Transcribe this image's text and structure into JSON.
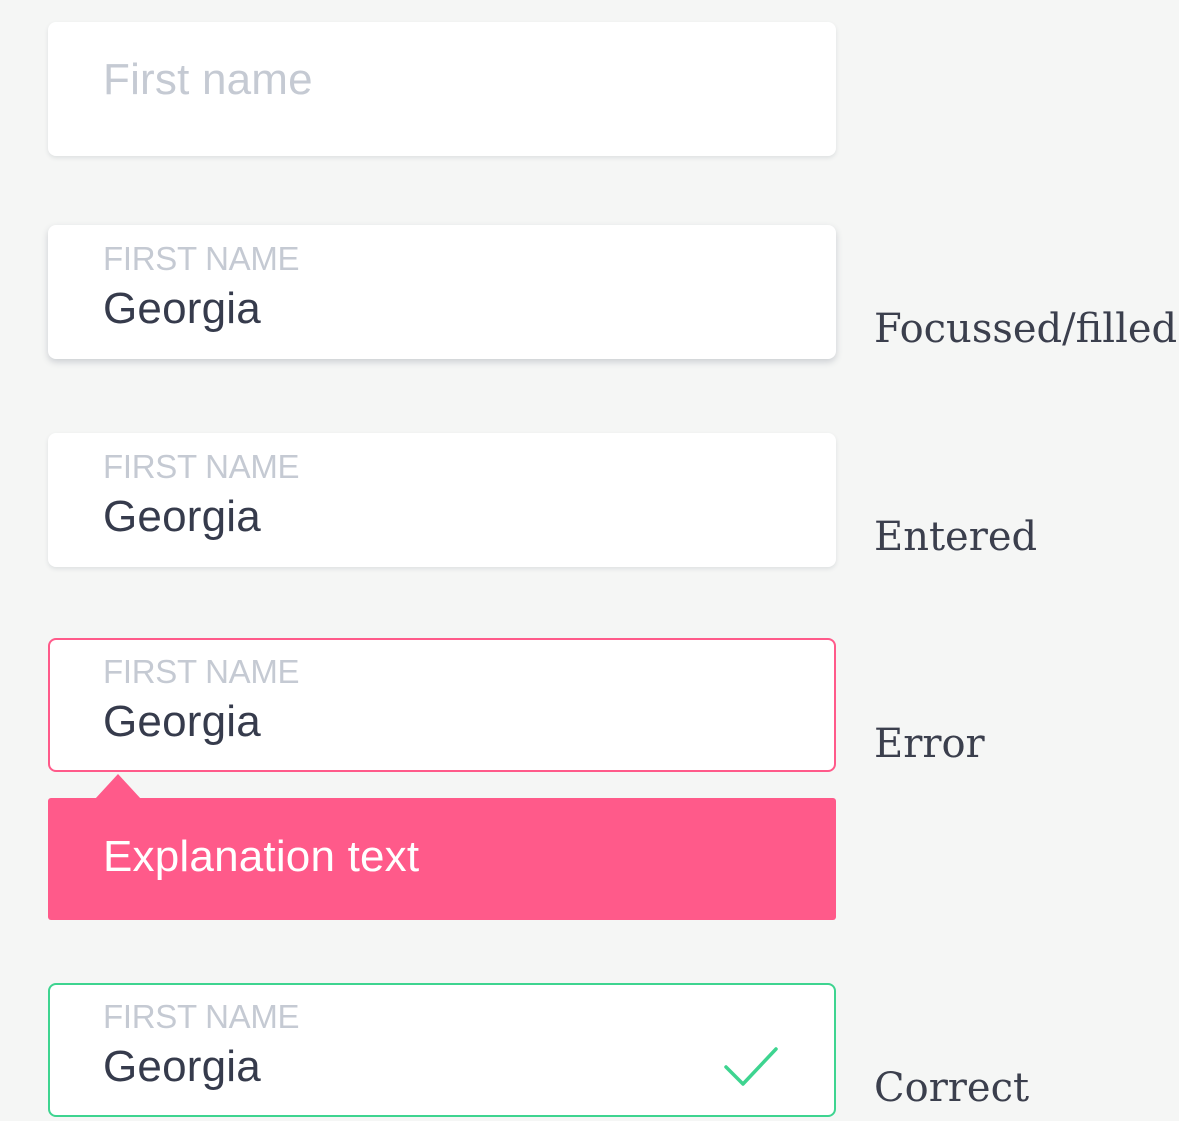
{
  "colors": {
    "background": "#f5f6f5",
    "label": "#c5cad3",
    "value": "#363b4c",
    "error": "#ff5a8a",
    "success": "#3ed490"
  },
  "fields": {
    "default": {
      "placeholder": "First name"
    },
    "focused": {
      "label": "FIRST NAME",
      "value": "Georgia",
      "state": "Focussed/filled"
    },
    "entered": {
      "label": "FIRST NAME",
      "value": "Georgia",
      "state": "Entered"
    },
    "error": {
      "label": "FIRST NAME",
      "value": "Georgia",
      "state": "Error",
      "message": "Explanation text"
    },
    "correct": {
      "label": "FIRST NAME",
      "value": "Georgia",
      "state": "Correct",
      "icon": "check-icon"
    }
  }
}
